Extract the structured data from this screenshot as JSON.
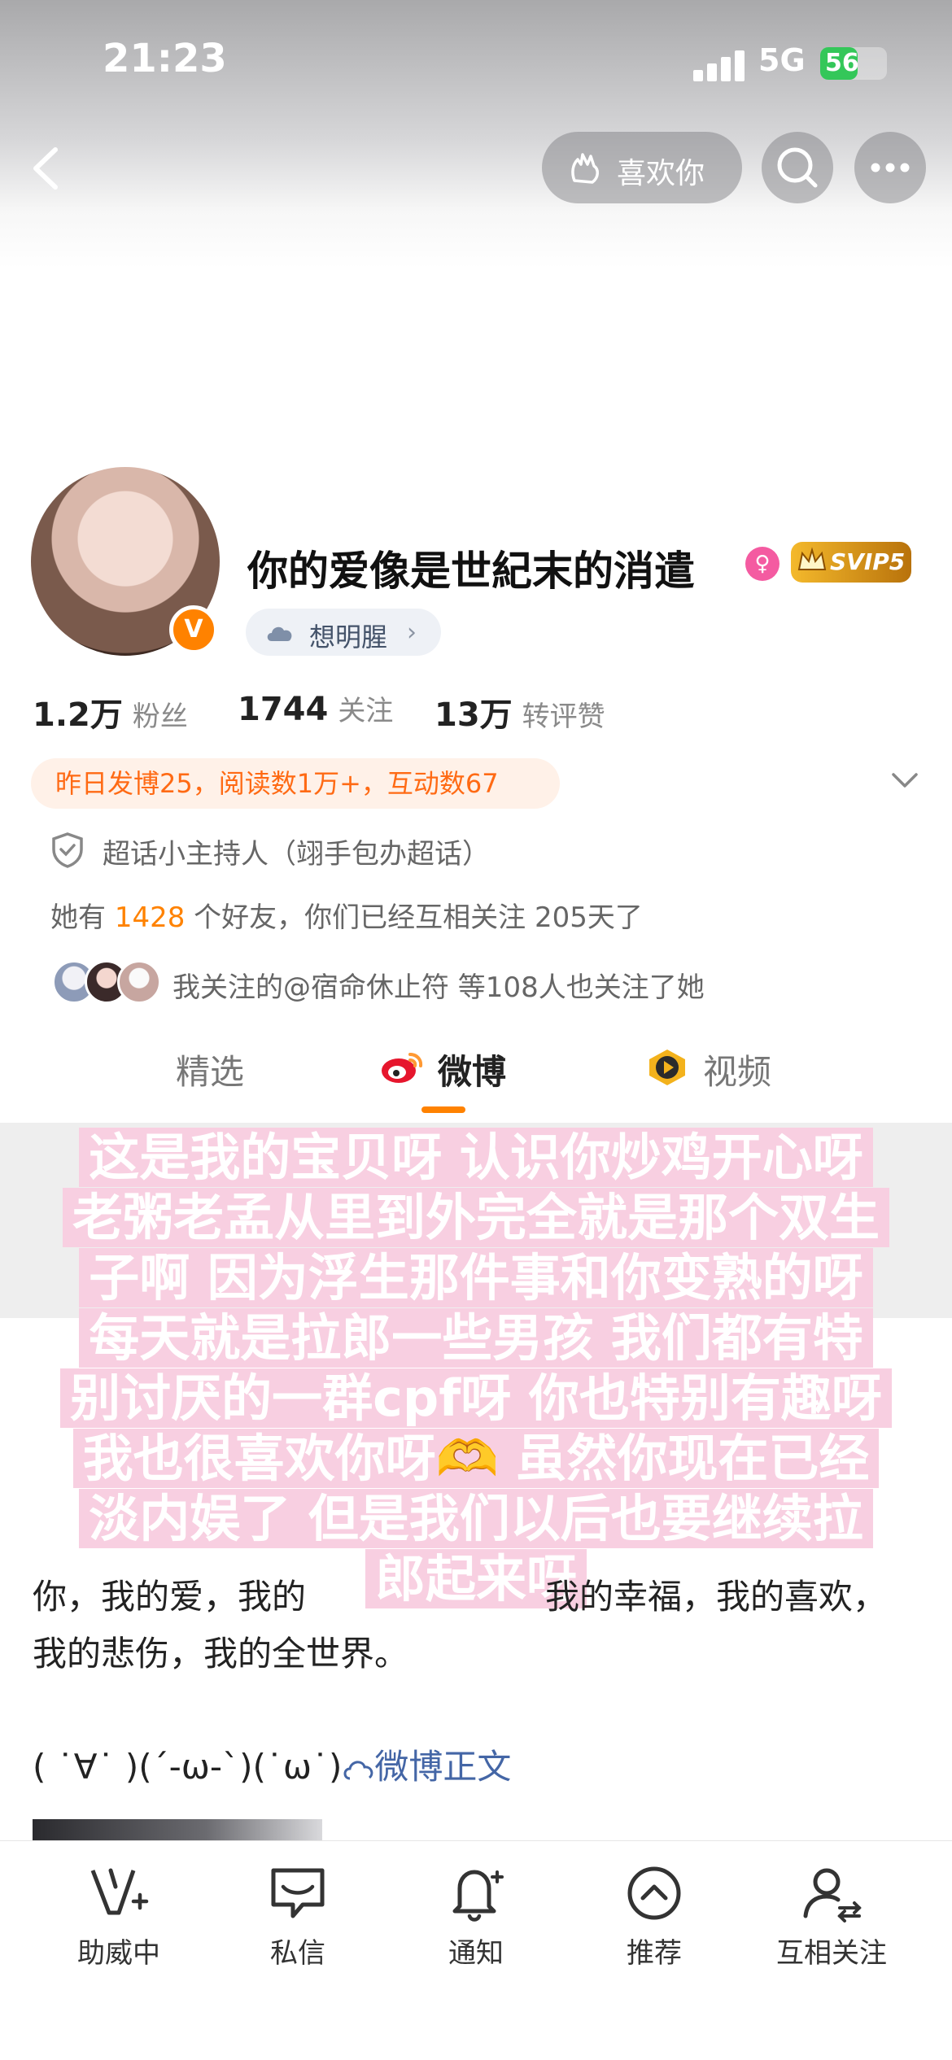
{
  "status": {
    "time": "21:23",
    "network": "5G",
    "battery": "56",
    "battery_level": 0.56
  },
  "header": {
    "like_label": "喜欢你"
  },
  "profile": {
    "name": "你的爱像是世紀末的消遣",
    "verify_mark": "V",
    "gender_mark": "♀",
    "vip_label": "SVIP5",
    "tag_label": "想明腥",
    "stats": [
      {
        "num": "1.2万",
        "label": "粉丝"
      },
      {
        "num": "1744",
        "label": "关注"
      },
      {
        "num": "13万",
        "label": "转评赞"
      }
    ],
    "yesterday": "昨日发博25，阅读数1万+，互动数67",
    "superhost": "超话小主持人（翊手包办超话）",
    "friends_prefix": "她有 ",
    "friends_count": "1428",
    "friends_suffix": " 个好友，你们已经互相关注 205天了",
    "mutual": "我关注的@宿命休止符 等108人也关注了她"
  },
  "tabs": [
    {
      "label": "精选"
    },
    {
      "label": "微博"
    },
    {
      "label": "视频"
    }
  ],
  "post": {
    "overlay_lines": [
      "这是我的宝贝呀 认识你炒鸡开心呀",
      "老粥老孟从里到外完全就是那个双生",
      "子啊 因为浮生那件事和你变熟的呀",
      "每天就是拉郎一些男孩 我们都有特",
      "别讨厌的一群cpf呀 你也特别有趣呀",
      "我也很喜欢你呀🫶 虽然你现在已经",
      "淡内娱了 但是我们以后也要继续拉",
      "郎起来呀"
    ],
    "body": "你，我的爱，我的　　　　　　　我的幸福，我的喜欢，我的悲伤，我的全世界。",
    "emoticon": "( ˙∀˙ )(´-ω-`)(˙ω˙)",
    "full_text_link": "微博正文"
  },
  "bottom_bar": [
    {
      "label": "助威中",
      "icon": "cheer-v-icon"
    },
    {
      "label": "私信",
      "icon": "message-icon"
    },
    {
      "label": "通知",
      "icon": "bell-icon"
    },
    {
      "label": "推荐",
      "icon": "recommend-icon"
    },
    {
      "label": "互相关注",
      "icon": "mutual-follow-icon"
    }
  ]
}
